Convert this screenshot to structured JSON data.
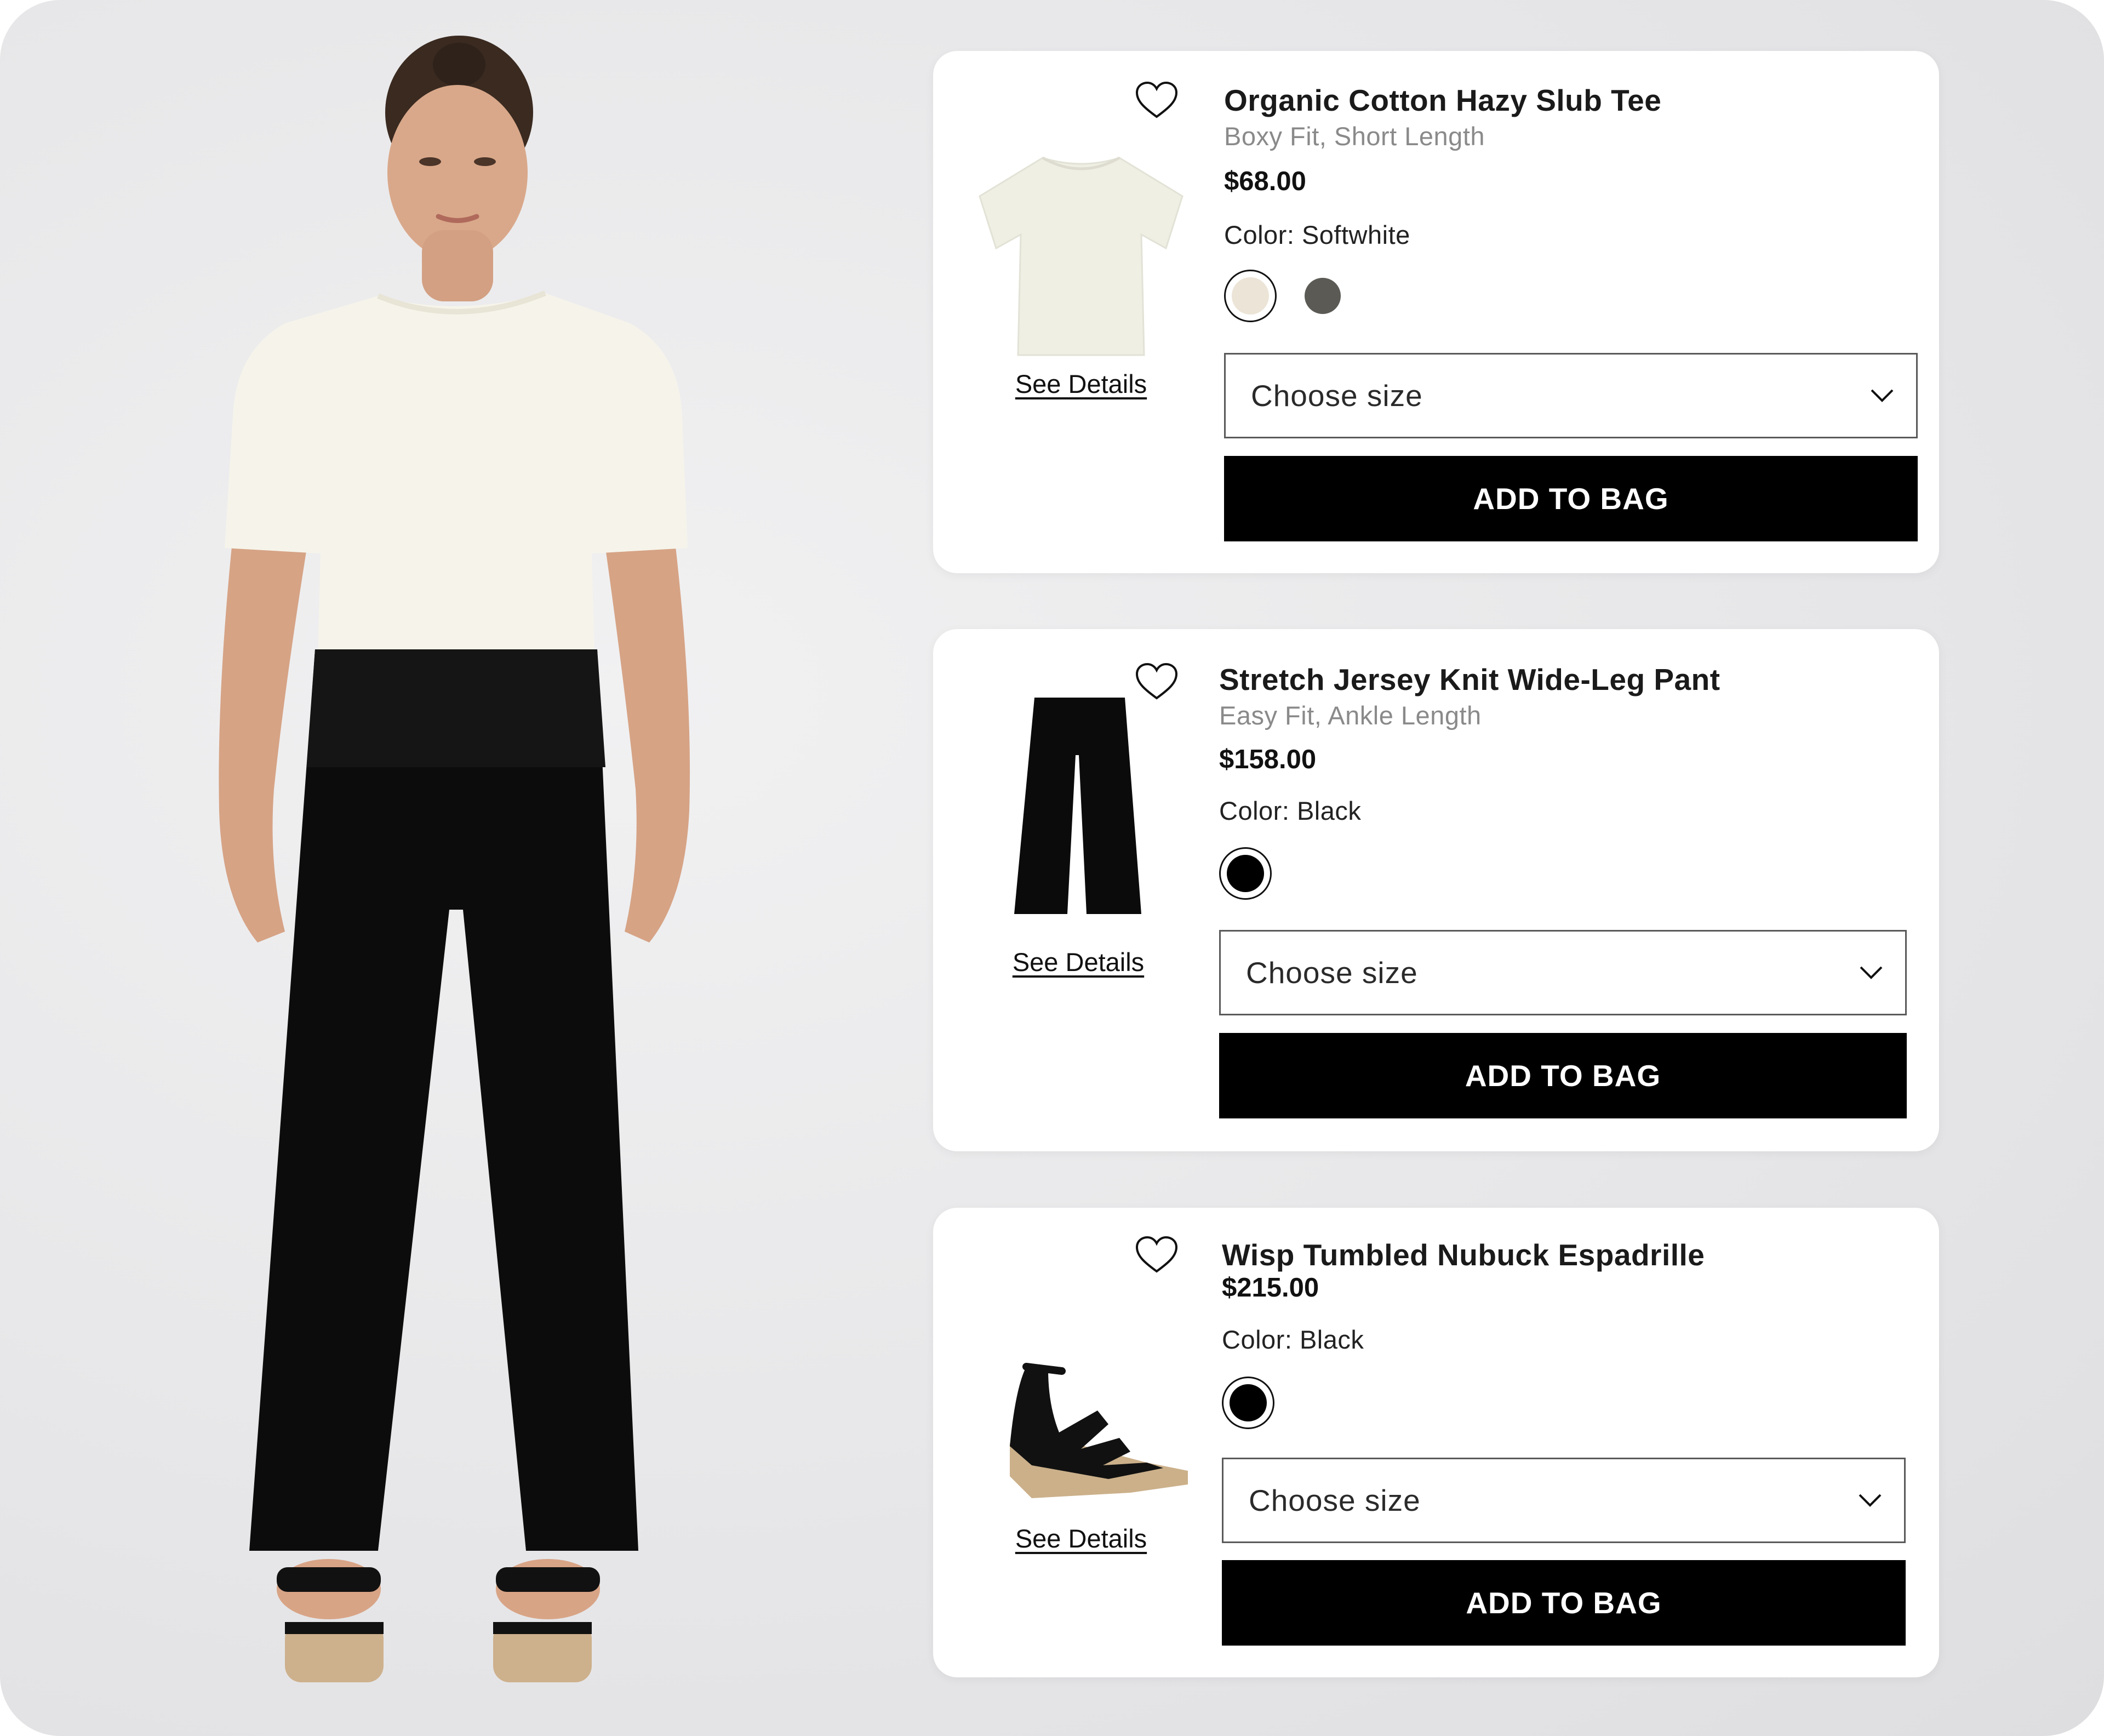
{
  "products": [
    {
      "title": "Organic Cotton Hazy Slub Tee",
      "subtitle": "Boxy Fit, Short Length",
      "price": "$68.00",
      "color_label": "Color:",
      "color_value": "Softwhite",
      "swatches": [
        {
          "color": "#ece4d6",
          "selected": true
        },
        {
          "color": "#5b5a55",
          "selected": false
        }
      ],
      "size_placeholder": "Choose size",
      "add_label": "ADD TO BAG",
      "details_label": "See Details",
      "favorite_icon": "heart-outline-icon",
      "thumbnail_icon": "tshirt-thumbnail"
    },
    {
      "title": "Stretch Jersey Knit Wide-Leg Pant",
      "subtitle": "Easy Fit, Ankle Length",
      "price": "$158.00",
      "color_label": "Color:",
      "color_value": "Black",
      "swatches": [
        {
          "color": "#000000",
          "selected": true
        }
      ],
      "size_placeholder": "Choose size",
      "add_label": "ADD TO BAG",
      "details_label": "See Details",
      "favorite_icon": "heart-outline-icon",
      "thumbnail_icon": "pants-thumbnail"
    },
    {
      "title": "Wisp Tumbled Nubuck Espadrille",
      "price": "$215.00",
      "color_label": "Color:",
      "color_value": "Black",
      "swatches": [
        {
          "color": "#000000",
          "selected": true
        }
      ],
      "size_placeholder": "Choose size",
      "add_label": "ADD TO BAG",
      "details_label": "See Details",
      "favorite_icon": "heart-outline-icon",
      "thumbnail_icon": "espadrille-thumbnail"
    }
  ],
  "colors": {
    "button_bg": "#000000",
    "button_text": "#ffffff",
    "card_bg": "#ffffff",
    "page_bg": "#e8e8ea",
    "subtitle_text": "#8a8a8a"
  }
}
